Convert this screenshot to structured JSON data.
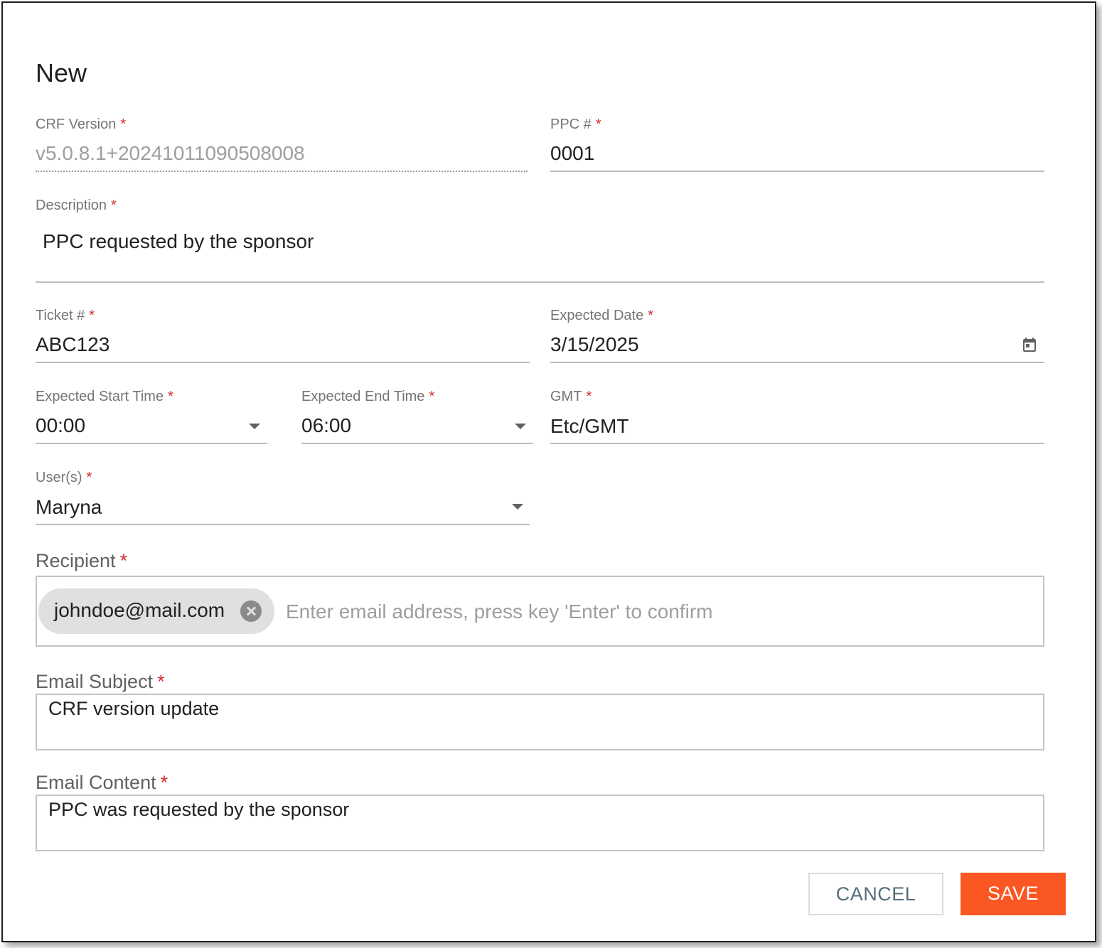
{
  "dialog": {
    "title": "New"
  },
  "fields": {
    "crf_version": {
      "label": "CRF Version",
      "value": "v5.0.8.1+20241011090508008"
    },
    "ppc_number": {
      "label": "PPC #",
      "value": "0001"
    },
    "description": {
      "label": "Description",
      "value": "PPC requested by the sponsor"
    },
    "ticket": {
      "label": "Ticket #",
      "value": "ABC123"
    },
    "expected_date": {
      "label": "Expected Date",
      "value": "3/15/2025",
      "icon": "calendar-icon"
    },
    "start_time": {
      "label": "Expected Start Time",
      "value": "00:00"
    },
    "end_time": {
      "label": "Expected End Time",
      "value": "06:00"
    },
    "gmt": {
      "label": "GMT",
      "value": "Etc/GMT"
    },
    "users": {
      "label": "User(s)",
      "value": "Maryna"
    }
  },
  "recipient": {
    "label": "Recipient",
    "chips": [
      "johndoe@mail.com"
    ],
    "placeholder": "Enter email address, press key 'Enter' to confirm"
  },
  "email_subject": {
    "label": "Email Subject",
    "value": "CRF version update"
  },
  "email_content": {
    "label": "Email Content",
    "value": "PPC was requested by the sponsor"
  },
  "required_marker": "*",
  "actions": {
    "cancel": "CANCEL",
    "save": "SAVE"
  },
  "colors": {
    "required": "#d32f2f",
    "save_button": "#fa5722",
    "cancel_text": "#546e7a"
  }
}
